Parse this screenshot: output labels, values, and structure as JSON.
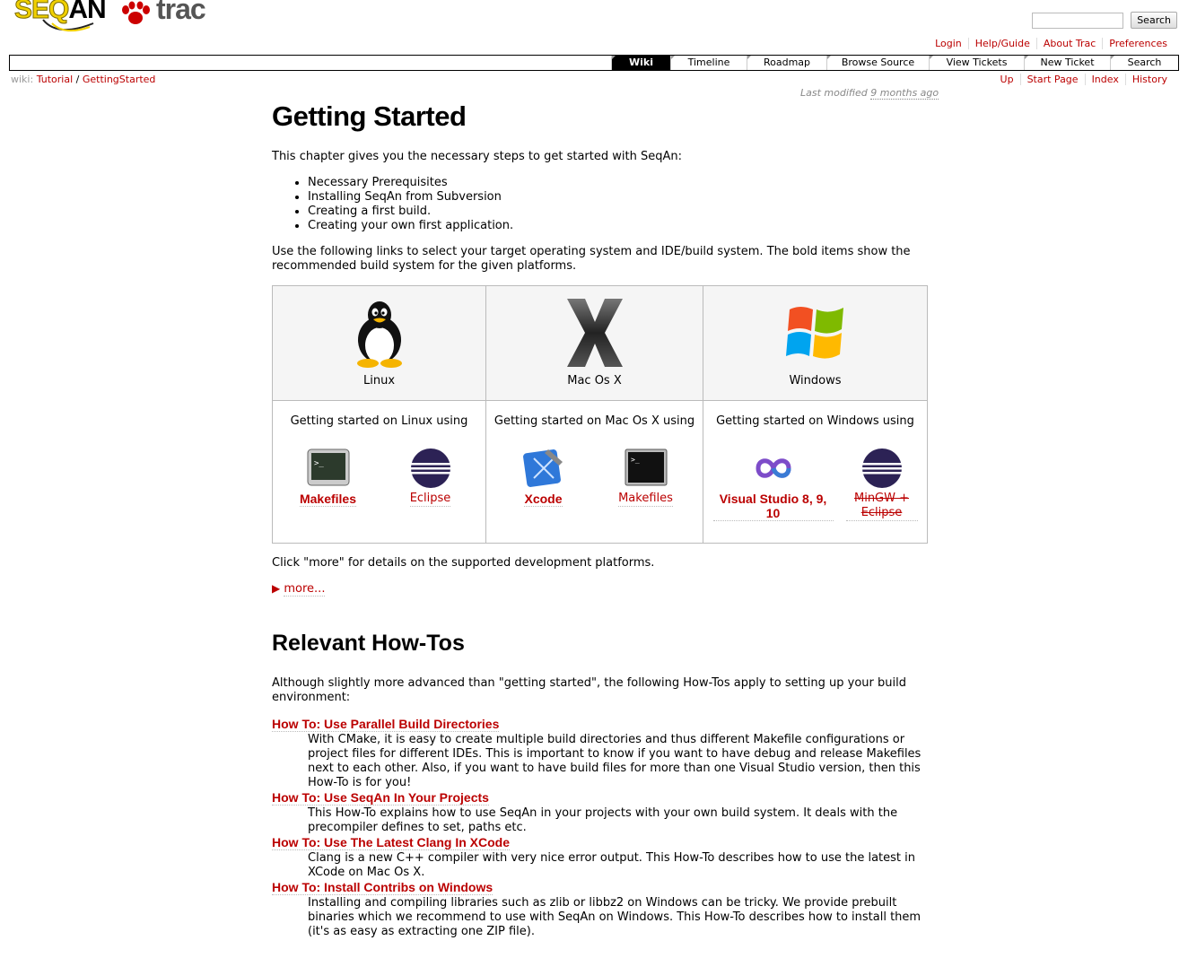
{
  "header": {
    "logo_text_a": "SEQ",
    "logo_text_b": "AN",
    "logo_trac": "trac",
    "search_button": "Search",
    "search_value": ""
  },
  "metanav": [
    "Login",
    "Help/Guide",
    "About Trac",
    "Preferences"
  ],
  "mainnav": [
    "Wiki",
    "Timeline",
    "Roadmap",
    "Browse Source",
    "View Tickets",
    "New Ticket",
    "Search"
  ],
  "mainnav_active": "Wiki",
  "ctxtnav": [
    "Up",
    "Start Page",
    "Index",
    "History"
  ],
  "pagepath": {
    "prefix": "wiki:",
    "parent": "Tutorial",
    "sep": "/",
    "current": "GettingStarted"
  },
  "lastmod": {
    "prefix": "Last modified",
    "age": "9 months ago"
  },
  "content": {
    "title": "Getting Started",
    "intro": "This chapter gives you the necessary steps to get started with SeqAn:",
    "steps": [
      "Necessary Prerequisites",
      "Installing SeqAn from Subversion",
      "Creating a first build.",
      "Creating your own first application."
    ],
    "select_text": "Use the following links to select your target operating system and IDE/build system. The bold items show the recommended build system for the given platforms.",
    "platforms": [
      {
        "os": "Linux",
        "using": "Getting started on Linux using",
        "tools": [
          {
            "label": "Makefiles",
            "icon": "terminal-icon"
          },
          {
            "label": "Eclipse",
            "icon": "eclipse-icon"
          }
        ]
      },
      {
        "os": "Mac Os X",
        "using": "Getting started on Mac Os X using",
        "tools": [
          {
            "label": "Xcode",
            "icon": "xcode-icon"
          },
          {
            "label": "Makefiles",
            "icon": "terminal-icon"
          }
        ]
      },
      {
        "os": "Windows",
        "using": "Getting started on Windows using",
        "tools": [
          {
            "label": "Visual Studio 8, 9, 10",
            "icon": "visual-studio-icon"
          },
          {
            "label": "MinGW + Eclipse",
            "icon": "eclipse-icon"
          }
        ]
      }
    ],
    "more_intro": "Click \"more\" for details on the supported development platforms.",
    "more_link": "more...",
    "howtos_title": "Relevant How-Tos",
    "howtos_intro": "Although slightly more advanced than \"getting started\", the following How-Tos apply to setting up your build environment:",
    "howtos": [
      {
        "title": "How To: Use Parallel Build Directories",
        "desc": "With CMake, it is easy to create multiple build directories and thus different Makefile configurations or project files for different IDEs. This is important to know if you want to have debug and release Makefiles next to each other. Also, if you want to have build files for more than one Visual Studio version, then this How-To is for you!"
      },
      {
        "title": "How To: Use SeqAn In Your Projects",
        "desc": "This How-To explains how to use SeqAn in your projects with your own build system. It deals with the precompiler defines to set, paths etc."
      },
      {
        "title": "How To: Use The Latest Clang In XCode",
        "desc": "Clang is a new C++ compiler with very nice error output. This How-To describes how to use the latest in XCode on Mac Os X."
      },
      {
        "title": "How To: Install Contribs on Windows",
        "desc": "Installing and compiling libraries such as zlib or libbz2 on Windows can be tricky. We provide prebuilt binaries which we recommend to use with SeqAn on Windows. This How-To describes how to install them (it's as easy as extracting one ZIP file)."
      }
    ]
  },
  "colors": {
    "link": "#bb0000",
    "nav_active_bg": "#000000",
    "logo_yellow": "#f0d000"
  }
}
